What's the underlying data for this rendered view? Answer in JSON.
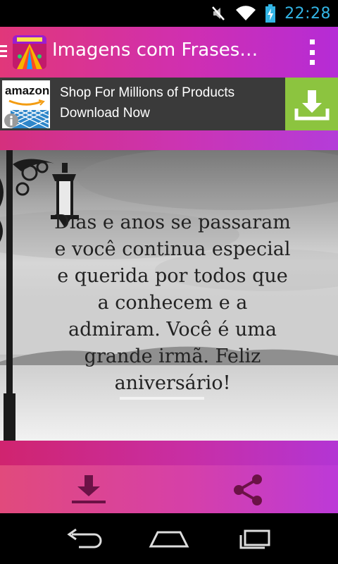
{
  "status_bar": {
    "time": "22:28",
    "icons": [
      "mute-icon",
      "wifi-icon",
      "battery-charging-icon"
    ]
  },
  "app_bar": {
    "title": "Imagens com Frases…",
    "icons": [
      "drawer-icon",
      "app-logo",
      "overflow-menu-icon"
    ]
  },
  "ad": {
    "brand": "amazon",
    "line1": "Shop For Millions of Products",
    "line2": "Download Now",
    "icons": [
      "info-icon",
      "download-icon"
    ]
  },
  "quote": {
    "text": "Dias e anos se passaram\ne você continua especial\ne querida por todos que\na conhecem e a\nadmiram. Você é uma\ngrande irmã. Feliz\naniversário!"
  },
  "actions": {
    "icons": [
      "download-icon",
      "share-icon"
    ]
  },
  "nav": {
    "icons": [
      "back-icon",
      "home-icon",
      "recent-apps-icon"
    ]
  },
  "colors": {
    "accent_pink": "#e1377a",
    "accent_purple": "#b52cd6",
    "status_time": "#33b5e5",
    "ad_button": "#8cc43f"
  }
}
